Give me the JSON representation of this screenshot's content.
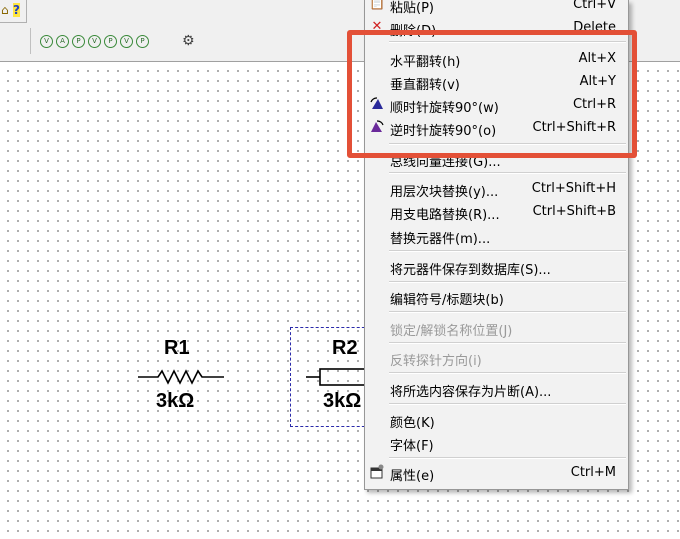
{
  "toolbar": {
    "help_icon": "?",
    "sim_icons": [
      "V",
      "A",
      "P",
      "V",
      "P",
      "V",
      "P"
    ]
  },
  "components": [
    {
      "ref": "R1",
      "value": "3kΩ"
    },
    {
      "ref": "R2",
      "value": "3kΩ"
    }
  ],
  "menu": {
    "paste": {
      "label": "粘贴(P)",
      "shortcut": "Ctrl+V"
    },
    "delete": {
      "label": "删除(D)",
      "shortcut": "Delete"
    },
    "flip_h": {
      "label": "水平翻转(h)",
      "shortcut": "Alt+X"
    },
    "flip_v": {
      "label": "垂直翻转(v)",
      "shortcut": "Alt+Y"
    },
    "rotate_cw": {
      "label": "顺时针旋转90°(w)",
      "shortcut": "Ctrl+R"
    },
    "rotate_ccw": {
      "label": "逆时针旋转90°(o)",
      "shortcut": "Ctrl+Shift+R"
    },
    "bus_vector": {
      "label": "总线向量连接(G)...",
      "shortcut": ""
    },
    "replace_hier": {
      "label": "用层次块替换(y)...",
      "shortcut": "Ctrl+Shift+H"
    },
    "replace_sub": {
      "label": "用支电路替换(R)...",
      "shortcut": "Ctrl+Shift+B"
    },
    "replace_comp": {
      "label": "替换元器件(m)...",
      "shortcut": ""
    },
    "save_db": {
      "label": "将元器件保存到数据库(S)...",
      "shortcut": ""
    },
    "edit_symbol": {
      "label": "编辑符号/标题块(b)",
      "shortcut": ""
    },
    "lock_name": {
      "label": "锁定/解锁名称位置(J)",
      "shortcut": ""
    },
    "reverse_probe": {
      "label": "反转探针方向(i)",
      "shortcut": ""
    },
    "save_snippet": {
      "label": "将所选内容保存为片断(A)...",
      "shortcut": ""
    },
    "color": {
      "label": "颜色(K)",
      "shortcut": ""
    },
    "font": {
      "label": "字体(F)",
      "shortcut": ""
    },
    "properties": {
      "label": "属性(e)",
      "shortcut": "Ctrl+M"
    }
  },
  "colors": {
    "highlight": "#e35037",
    "selection": "#2a2aaa"
  }
}
